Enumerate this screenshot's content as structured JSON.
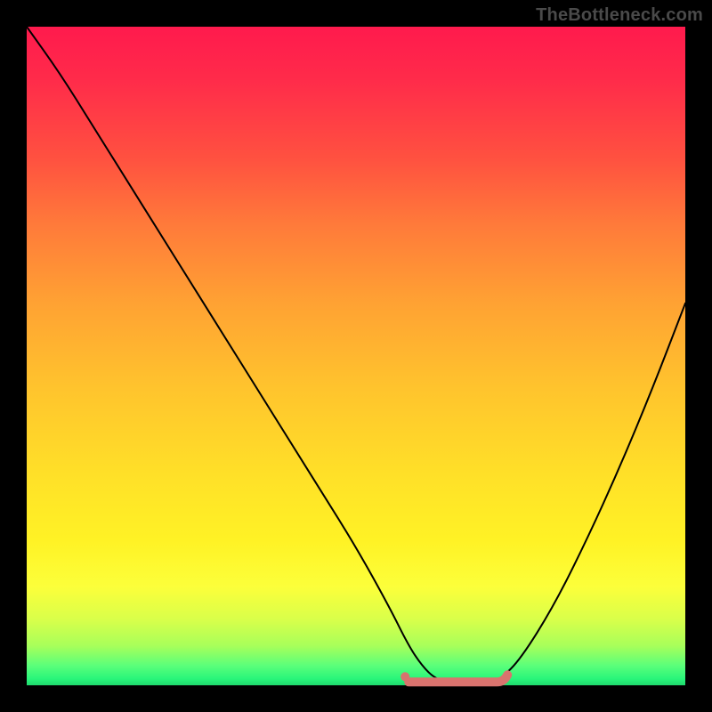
{
  "watermark": "TheBottleneck.com",
  "colors": {
    "background": "#000000",
    "curve_stroke": "#000000",
    "flat_marker": "#d9736e",
    "gradient_top": "#ff1a4d",
    "gradient_bottom": "#1fd96e"
  },
  "chart_data": {
    "type": "line",
    "title": "",
    "xlabel": "",
    "ylabel": "",
    "xlim": [
      0,
      100
    ],
    "ylim": [
      0,
      100
    ],
    "grid": false,
    "legend": false,
    "series": [
      {
        "name": "curve",
        "x": [
          0,
          5,
          10,
          15,
          20,
          25,
          30,
          35,
          40,
          45,
          50,
          55,
          58,
          60,
          62,
          65,
          68,
          70,
          72,
          75,
          80,
          85,
          90,
          95,
          100
        ],
        "values": [
          100,
          93,
          85,
          77,
          69,
          61,
          53,
          45,
          37,
          29,
          21,
          12,
          6,
          3,
          1,
          0,
          0,
          0,
          1,
          4,
          12,
          22,
          33,
          45,
          58
        ]
      }
    ],
    "annotations": [
      {
        "name": "optimal-flat-region",
        "shape": "rounded-segment",
        "x_start": 58,
        "x_end": 73,
        "y": 0.5,
        "color": "#d9736e"
      }
    ]
  }
}
